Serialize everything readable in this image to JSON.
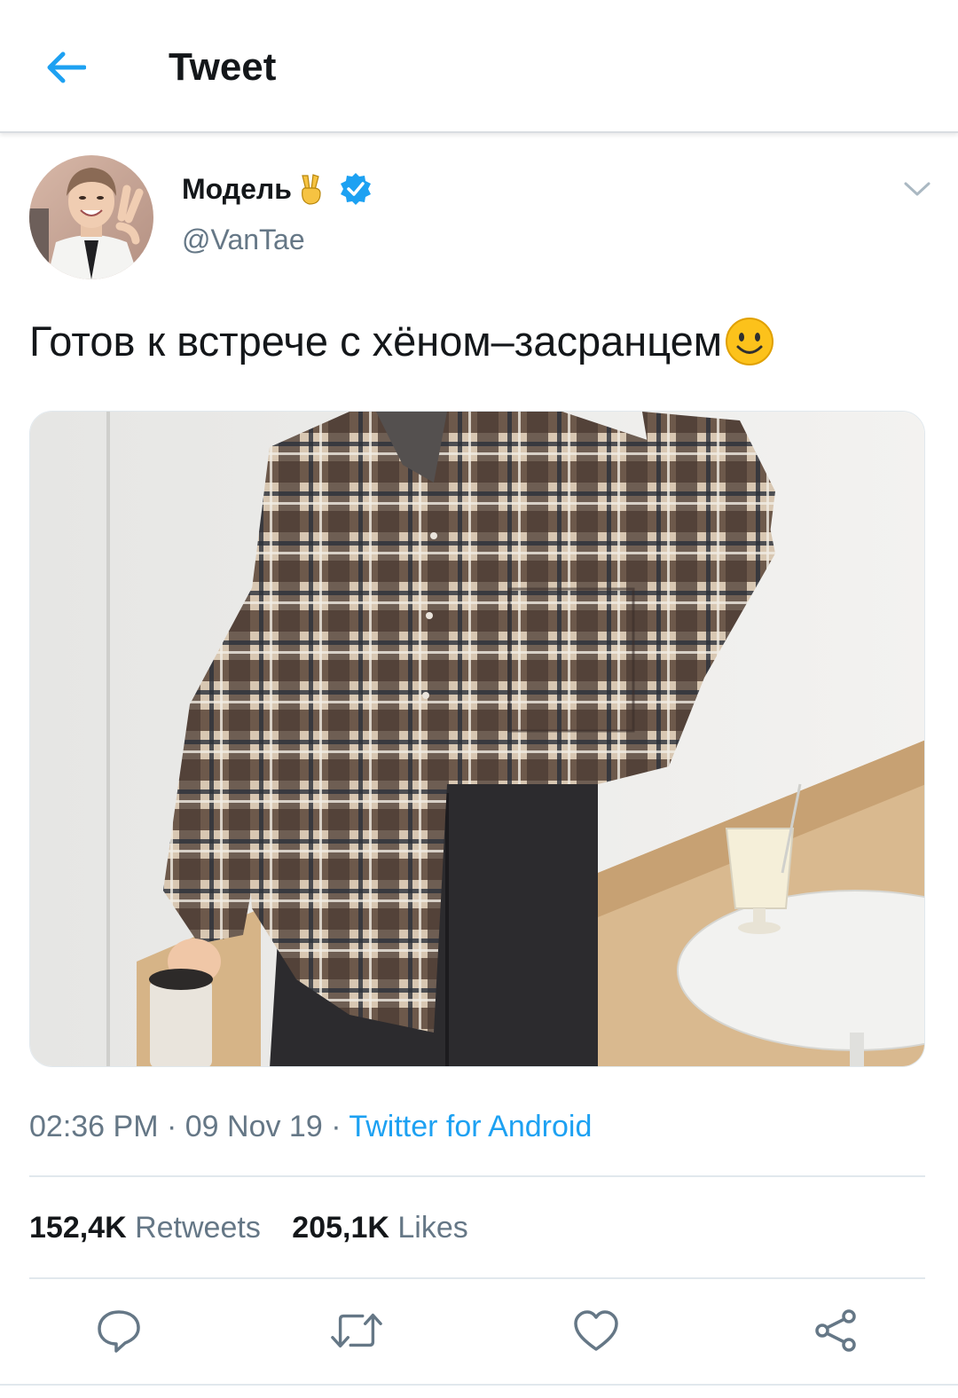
{
  "header": {
    "title": "Tweet",
    "back_icon": "back-arrow-icon"
  },
  "author": {
    "display_name": "Модель",
    "name_emoji": "victory-hand-emoji",
    "verified": true,
    "handle": "@VanTae"
  },
  "tweet": {
    "text": "Готов к встрече с хёном–засранцем",
    "trailing_emoji": "smiling-face-emoji",
    "media_alt": "photo-plaid-shirt"
  },
  "meta": {
    "time": "02:36 PM",
    "separator1": " · ",
    "date": "09 Nov 19",
    "separator2": " · ",
    "source": "Twitter for Android"
  },
  "stats": {
    "retweets_count": "152,4K",
    "retweets_label": "Retweets",
    "likes_count": "205,1K",
    "likes_label": "Likes"
  },
  "actions": [
    "reply-icon",
    "retweet-icon",
    "like-icon",
    "share-icon"
  ],
  "colors": {
    "accent": "#1da1f2",
    "text_primary": "#14171a",
    "text_secondary": "#657786",
    "divider": "#e1e8ed"
  }
}
